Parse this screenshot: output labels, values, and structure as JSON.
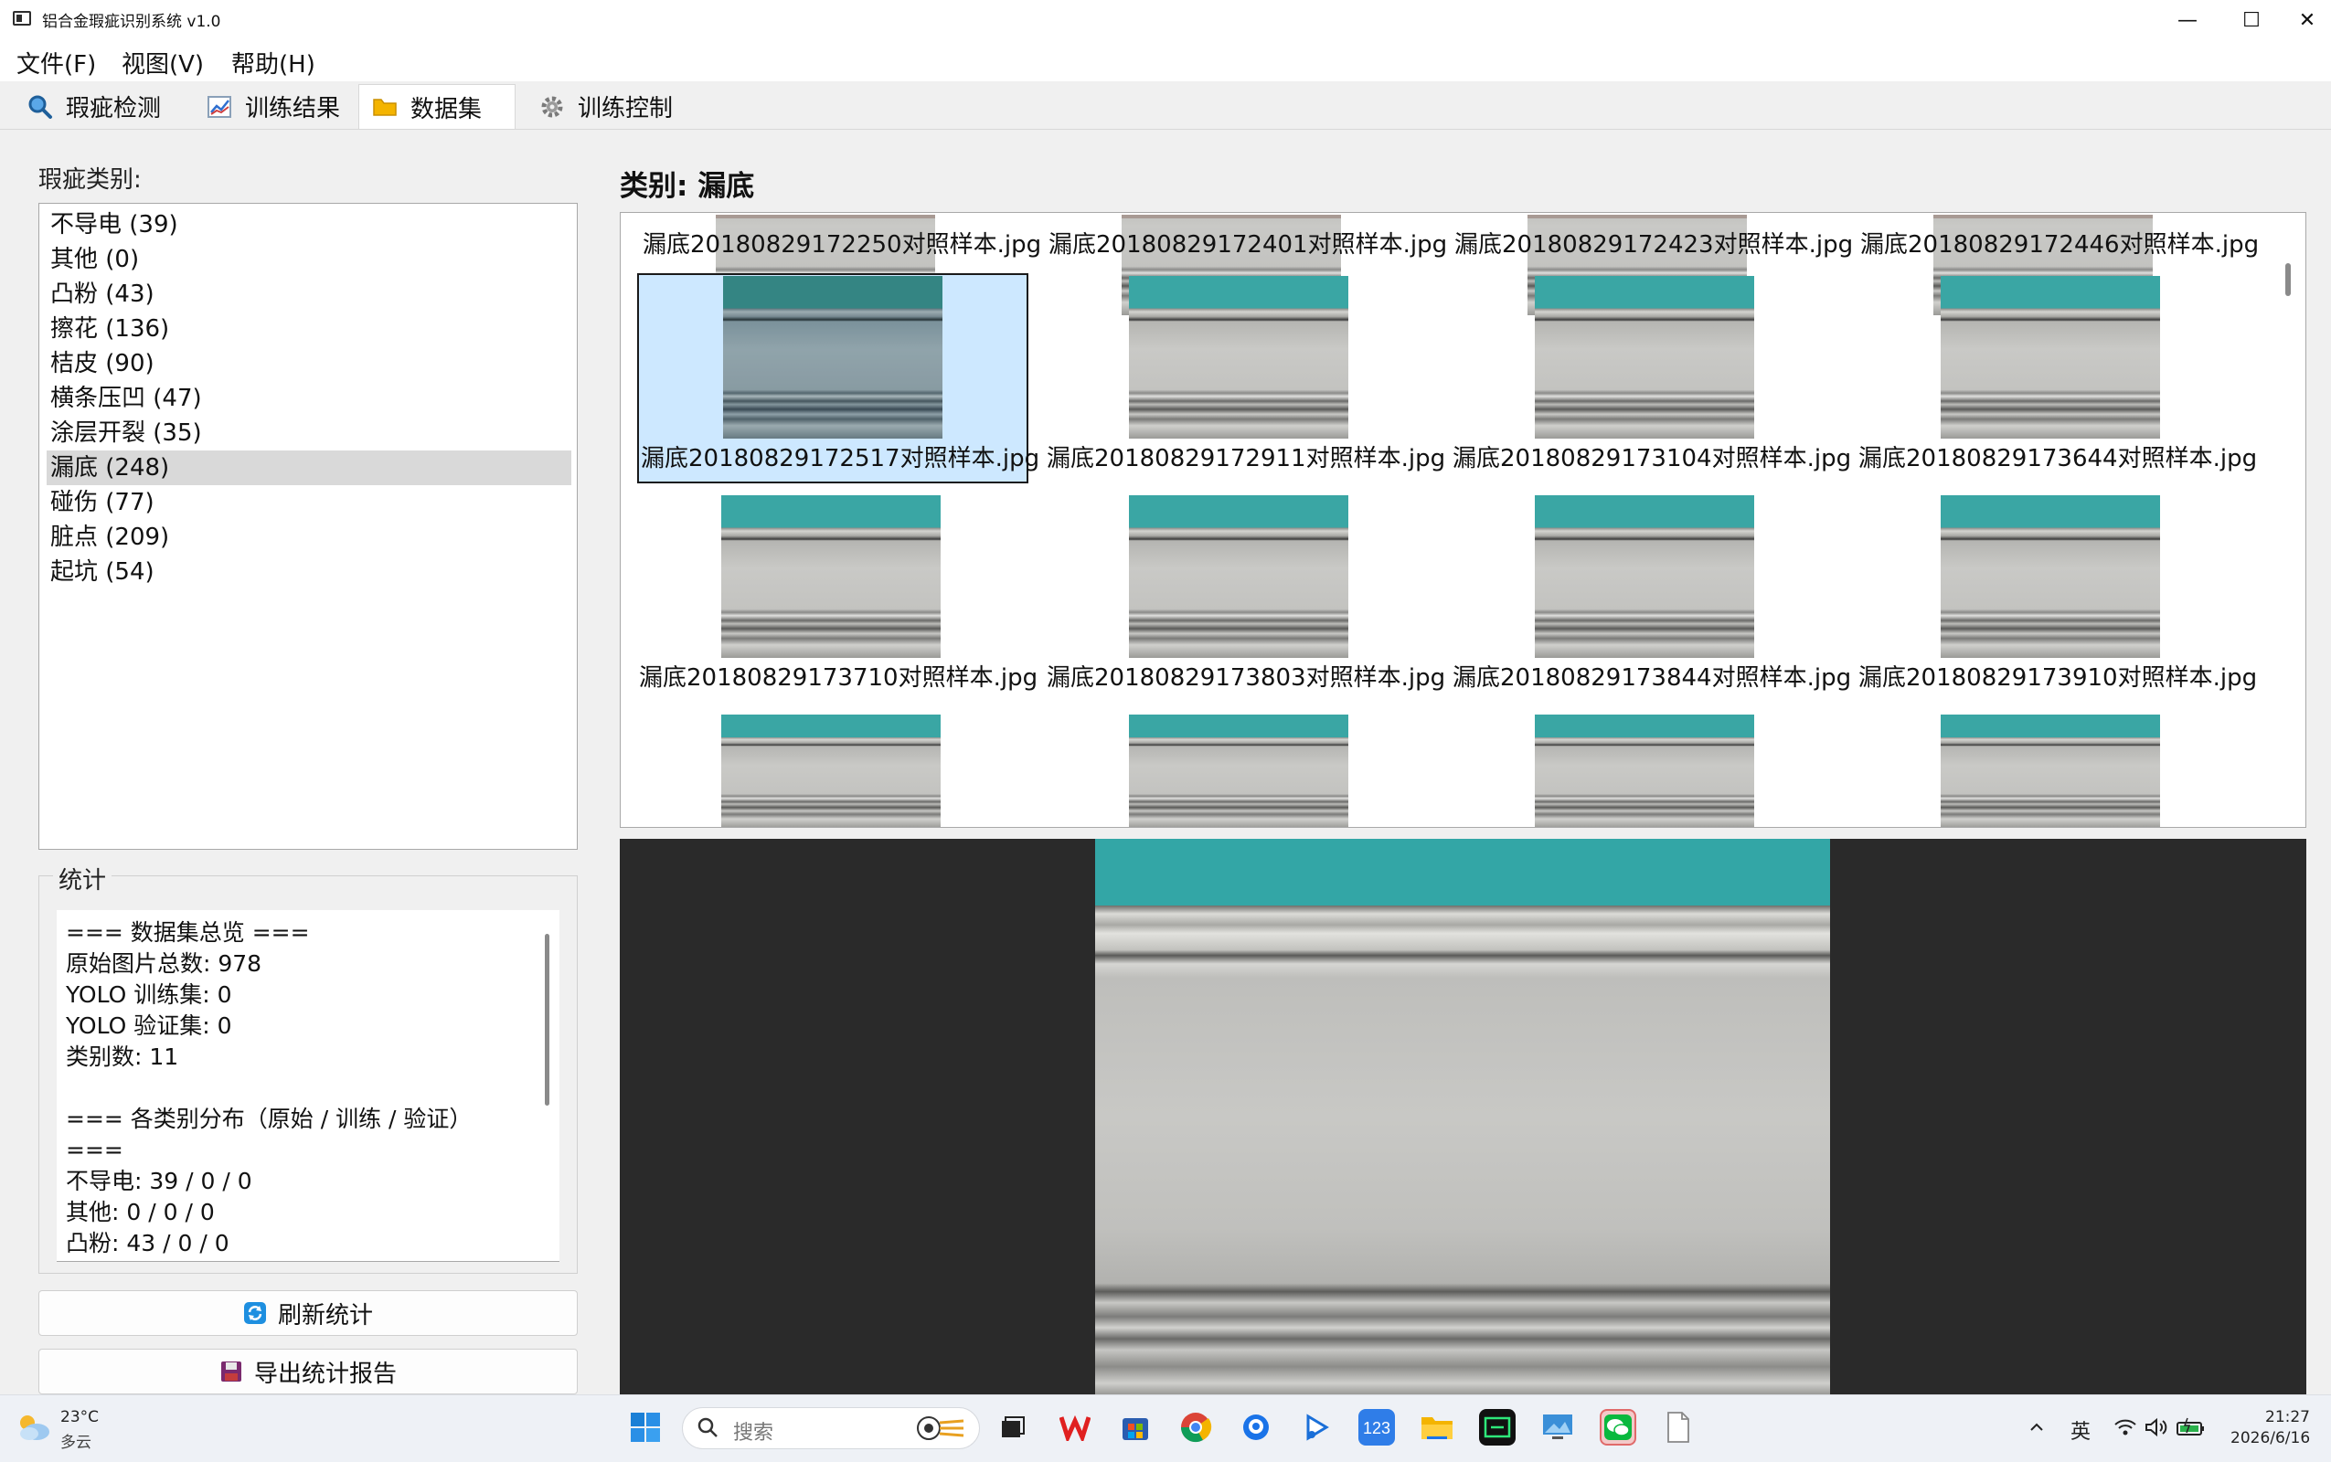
{
  "window": {
    "title": "铝合金瑕疵识别系统 v1.0",
    "minimize": "—",
    "maximize": "☐",
    "close": "✕"
  },
  "menu": [
    "文件(F)",
    "视图(V)",
    "帮助(H)"
  ],
  "tabs": [
    {
      "label": "瑕疵检测",
      "icon": "magnifier-icon"
    },
    {
      "label": "训练结果",
      "icon": "chart-icon"
    },
    {
      "label": "数据集",
      "icon": "folder-icon",
      "active": true
    },
    {
      "label": "训练控制",
      "icon": "gear-icon"
    }
  ],
  "left": {
    "category_label": "瑕疵类别:",
    "categories": [
      "不导电 (39)",
      "其他 (0)",
      "凸粉 (43)",
      "擦花 (136)",
      "桔皮 (90)",
      "横条压凹 (47)",
      "涂层开裂 (35)",
      "漏底 (248)",
      "碰伤 (77)",
      "脏点 (209)",
      "起坑 (54)"
    ],
    "selected_index": 7,
    "stats_title": "统计",
    "stats_lines": [
      "=== 数据集总览 ===",
      "原始图片总数: 978",
      "YOLO 训练集: 0",
      "YOLO 验证集: 0",
      "类别数: 11",
      "",
      "=== 各类别分布（原始 / 训练 / 验证）",
      "===",
      "不导电: 39 / 0 / 0",
      "其他: 0 / 0 / 0",
      "凸粉: 43 / 0 / 0"
    ],
    "refresh_button": "刷新统计",
    "export_button": "导出统计报告"
  },
  "right": {
    "category_title": "类别: 漏底",
    "thumbnails": [
      "漏底20180829172250对照样本.jpg",
      "漏底20180829172401对照样本.jpg",
      "漏底20180829172423对照样本.jpg",
      "漏底20180829172446对照样本.jpg",
      "漏底20180829172517对照样本.jpg",
      "漏底20180829172911对照样本.jpg",
      "漏底20180829173104对照样本.jpg",
      "漏底20180829173644对照样本.jpg",
      "漏底20180829173710对照样本.jpg",
      "漏底20180829173803对照样本.jpg",
      "漏底20180829173844对照样本.jpg",
      "漏底20180829173910对照样本.jpg"
    ],
    "selected_thumbnail": 4
  },
  "taskbar": {
    "temperature": "23°C",
    "weather": "多云",
    "search_placeholder": "搜索",
    "ime": "英",
    "time": "21:27",
    "date": "2026/6/16"
  },
  "colors": {
    "accent": "#0078d4",
    "selection": "#cde8ff",
    "list_selection": "#d9d9d9",
    "preview_bg": "#2a2a2a",
    "teal_strip": "#33a6a6"
  }
}
